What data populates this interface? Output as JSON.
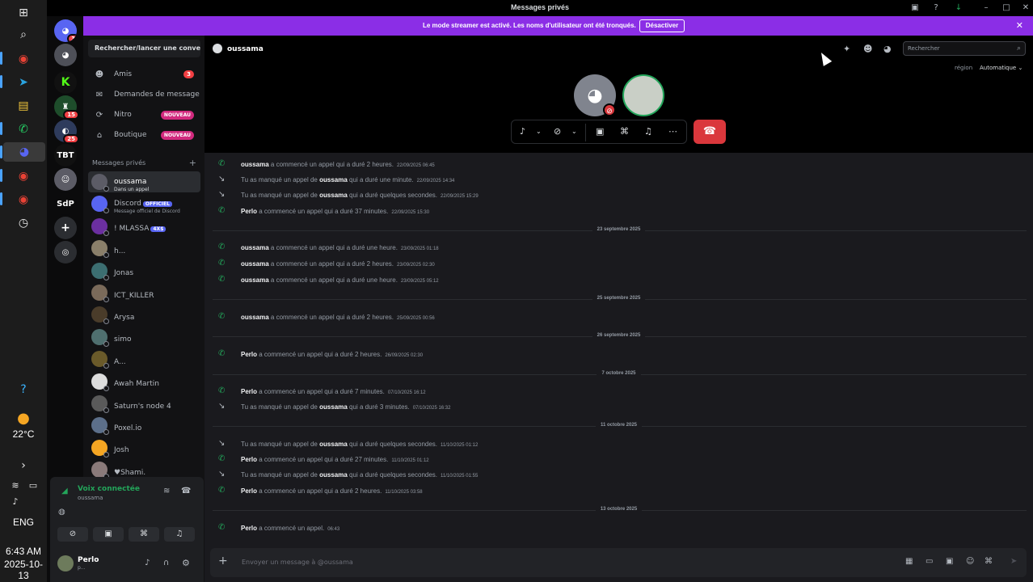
{
  "window": {
    "title": "Messages privés"
  },
  "taskbar": {
    "weather_temp": "22°C",
    "lang": "ENG",
    "time": "6:43 AM",
    "date": "2025-10-13"
  },
  "servers": {
    "home_badge": "3",
    "badges": [
      "15",
      "25"
    ],
    "labels": [
      "TBT",
      "SdP"
    ]
  },
  "banner": {
    "text": "Le mode streamer est activé. Les noms d'utilisateur ont été tronqués.",
    "button": "Désactiver"
  },
  "sidebar": {
    "search": "Rechercher/lancer une conver...",
    "nav": [
      {
        "label": "Amis",
        "badge": "3"
      },
      {
        "label": "Demandes de message"
      },
      {
        "label": "Nitro",
        "badge": "NOUVEAU"
      },
      {
        "label": "Boutique",
        "badge": "NOUVEAU"
      }
    ],
    "dm_header": "Messages privés",
    "dms": [
      {
        "name": "oussama",
        "sub": "Dans un appel"
      },
      {
        "name": "Discord",
        "tag": "OFFICIEL",
        "sub": "Message officiel de Discord"
      },
      {
        "name": "! MLASSA",
        "tag": "4X$"
      },
      {
        "name": "h..."
      },
      {
        "name": "Jonas"
      },
      {
        "name": "ICT_KILLER"
      },
      {
        "name": "Arysa"
      },
      {
        "name": "simo"
      },
      {
        "name": "A..."
      },
      {
        "name": "Awah Martin"
      },
      {
        "name": "Saturn's node 4"
      },
      {
        "name": "Poxel.io"
      },
      {
        "name": "Josh"
      },
      {
        "name": "♥Shami."
      }
    ]
  },
  "voice": {
    "title": "Voix connectée",
    "channel": "oussama"
  },
  "user": {
    "name": "Perlo",
    "status": "p..."
  },
  "main": {
    "channel": "oussama",
    "search_placeholder": "Rechercher",
    "region_label": "région",
    "region_value": "Automatique ⌄",
    "composer_placeholder": "Envoyer un message à @oussama"
  },
  "messages": [
    {
      "kind": "ok",
      "user": "oussama",
      "text": "a commencé un appel qui a duré 2 heures.",
      "ts": "22/09/2025 06:45"
    },
    {
      "kind": "miss",
      "pre": "Tu as manqué un appel de",
      "user": "oussama",
      "text": "qui a duré une minute.",
      "ts": "22/09/2025 14:34"
    },
    {
      "kind": "miss",
      "pre": "Tu as manqué un appel de",
      "user": "oussama",
      "text": "qui a duré quelques secondes.",
      "ts": "22/09/2025 15:29"
    },
    {
      "kind": "ok",
      "user": "Perlo",
      "text": "a commencé un appel qui a duré 37 minutes.",
      "ts": "22/09/2025 15:30"
    },
    {
      "kind": "date",
      "label": "23 septembre 2025"
    },
    {
      "kind": "ok",
      "user": "oussama",
      "text": "a commencé un appel qui a duré une heure.",
      "ts": "23/09/2025 01:18"
    },
    {
      "kind": "ok",
      "user": "oussama",
      "text": "a commencé un appel qui a duré 2 heures.",
      "ts": "23/09/2025 02:30"
    },
    {
      "kind": "ok",
      "user": "oussama",
      "text": "a commencé un appel qui a duré une heure.",
      "ts": "23/09/2025 05:12"
    },
    {
      "kind": "date",
      "label": "25 septembre 2025"
    },
    {
      "kind": "ok",
      "user": "oussama",
      "text": "a commencé un appel qui a duré 2 heures.",
      "ts": "25/09/2025 00:56"
    },
    {
      "kind": "date",
      "label": "26 septembre 2025"
    },
    {
      "kind": "ok",
      "user": "Perlo",
      "text": "a commencé un appel qui a duré 2 heures.",
      "ts": "26/09/2025 02:30"
    },
    {
      "kind": "date",
      "label": "7 octobre 2025"
    },
    {
      "kind": "ok",
      "user": "Perlo",
      "text": "a commencé un appel qui a duré 7 minutes.",
      "ts": "07/10/2025 16:12"
    },
    {
      "kind": "miss",
      "pre": "Tu as manqué un appel de",
      "user": "oussama",
      "text": "qui a duré 3 minutes.",
      "ts": "07/10/2025 16:32"
    },
    {
      "kind": "date",
      "label": "11 octobre 2025"
    },
    {
      "kind": "miss",
      "pre": "Tu as manqué un appel de",
      "user": "oussama",
      "text": "qui a duré quelques secondes.",
      "ts": "11/10/2025 01:12"
    },
    {
      "kind": "ok",
      "user": "Perlo",
      "text": "a commencé un appel qui a duré 27 minutes.",
      "ts": "11/10/2025 01:12"
    },
    {
      "kind": "miss",
      "pre": "Tu as manqué un appel de",
      "user": "oussama",
      "text": "qui a duré quelques secondes.",
      "ts": "11/10/2025 01:55"
    },
    {
      "kind": "ok",
      "user": "Perlo",
      "text": "a commencé un appel qui a duré 2 heures.",
      "ts": "11/10/2025 03:58"
    },
    {
      "kind": "date",
      "label": "13 octobre 2025"
    },
    {
      "kind": "ok",
      "user": "Perlo",
      "text": "a commencé un appel.",
      "ts": "06:43"
    }
  ]
}
